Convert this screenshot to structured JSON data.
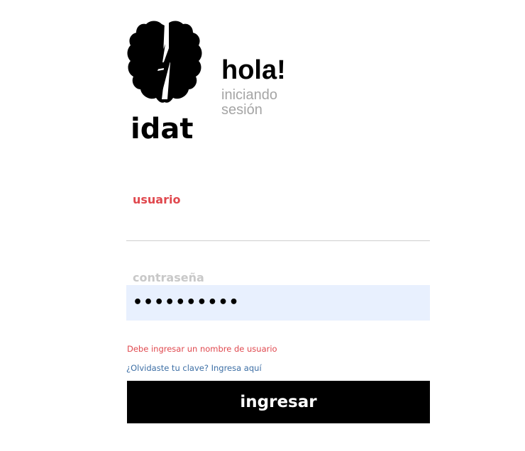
{
  "brand": {
    "logo_icon": "brain-bolt-icon",
    "logo_text": "idat"
  },
  "header": {
    "greeting": "hola!",
    "subtitle": "iniciando sesión"
  },
  "form": {
    "user_label": "usuario",
    "user_value": "",
    "password_label": "contraseña",
    "password_display": "••••••••••",
    "error_message": "Debe ingresar un nombre de usuario",
    "forgot_link": "¿Olvidaste tu clave? Ingresa aquí",
    "submit_label": "ingresar"
  },
  "colors": {
    "accent_red": "#e0484e",
    "link_blue": "#3d6fa5",
    "autofill_bg": "#e8f0fe",
    "button_bg": "#000000"
  }
}
